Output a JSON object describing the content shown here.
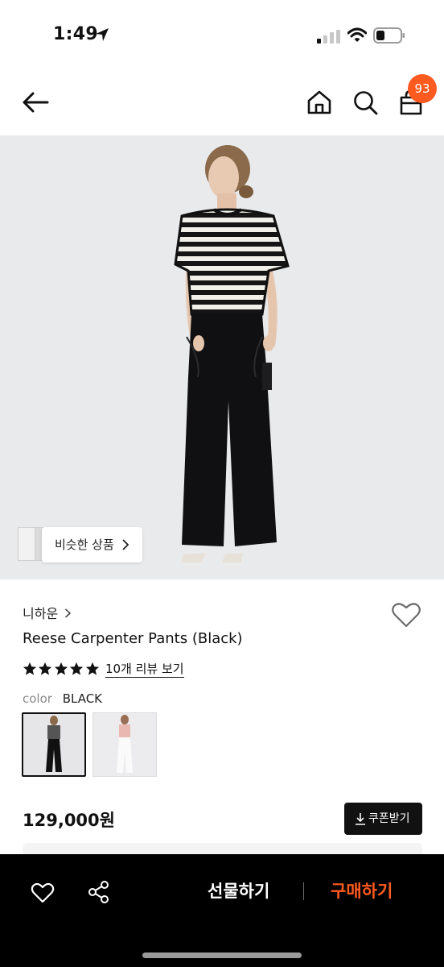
{
  "status_bar": {
    "time": "1:49",
    "icons": [
      "location-arrow-icon",
      "cellular-signal-icon",
      "wifi-icon",
      "battery-icon"
    ]
  },
  "header": {
    "icons": [
      "back-arrow-icon",
      "home-icon",
      "search-icon",
      "shopping-bag-icon"
    ],
    "cart_count": "93"
  },
  "product_image": {
    "similar_products_label": "비슷한 상품"
  },
  "product": {
    "brand": "니하운",
    "name": "Reese Carpenter Pants (Black)",
    "rating_stars": 5,
    "reviews_link": "10개 리뷰 보기",
    "color_label": "color",
    "color_value": "BLACK",
    "price": "129,000원",
    "coupon_label": "쿠폰받기"
  },
  "bottom_bar": {
    "gift_label": "선물하기",
    "buy_label": "구매하기"
  },
  "colors": {
    "accent": "#ff5a1f",
    "bottom_bar_bg": "#000000",
    "image_bg": "#e9eaec"
  }
}
